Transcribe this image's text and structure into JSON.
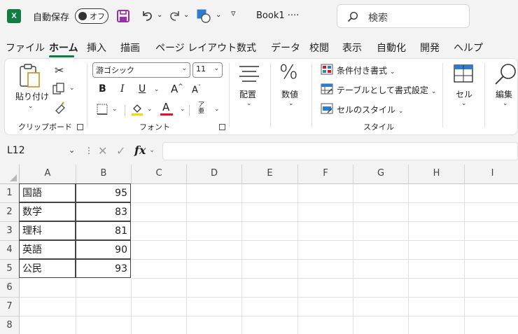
{
  "titlebar": {
    "logo_letter": "X",
    "autosave_label": "自動保存",
    "autosave_state": "オフ",
    "doc_title": "Book1 ·",
    "doc_title_more": "···",
    "search_placeholder": "検索",
    "qat_more": "▿"
  },
  "tabs": [
    "ファイル",
    "ホーム",
    "挿入",
    "描画",
    "ページ レイアウト",
    "数式",
    "データ",
    "校閲",
    "表示",
    "自動化",
    "開発",
    "ヘルプ"
  ],
  "active_tab": "ホーム",
  "ribbon": {
    "clipboard": {
      "paste": "貼り付け",
      "group": "クリップボード"
    },
    "font": {
      "name": "游ゴシック",
      "size": "11",
      "bold": "B",
      "italic": "I",
      "underline": "U",
      "grow": "A",
      "shrink": "A",
      "font_color_letter": "A",
      "phonetic": "ア",
      "group": "フォント"
    },
    "alignment": {
      "label": "配置"
    },
    "number": {
      "label": "数値",
      "symbol": "%"
    },
    "styles": {
      "conditional": "条件付き書式",
      "table": "テーブルとして書式設定",
      "cell_styles": "セルのスタイル",
      "group": "スタイル"
    },
    "cells": {
      "label": "セル"
    },
    "editing": {
      "label": "編集"
    },
    "accent_red": "#e81123",
    "accent_yellow": "#ffd800"
  },
  "formula_bar": {
    "name_box": "L12",
    "fx": "fx",
    "formula": ""
  },
  "sheet": {
    "columns": [
      "A",
      "B",
      "C",
      "D",
      "E",
      "F",
      "G",
      "H",
      "I"
    ],
    "rows": [
      "1",
      "2",
      "3",
      "4",
      "5",
      "6",
      "7",
      "8"
    ],
    "data": [
      [
        "国語",
        "95"
      ],
      [
        "数学",
        "83"
      ],
      [
        "理科",
        "81"
      ],
      [
        "英語",
        "90"
      ],
      [
        "公民",
        "93"
      ]
    ]
  },
  "colors": {
    "excel_green": "#107c41",
    "save_purple": "#9a2fae",
    "shape_blue": "#2b7cd3"
  }
}
